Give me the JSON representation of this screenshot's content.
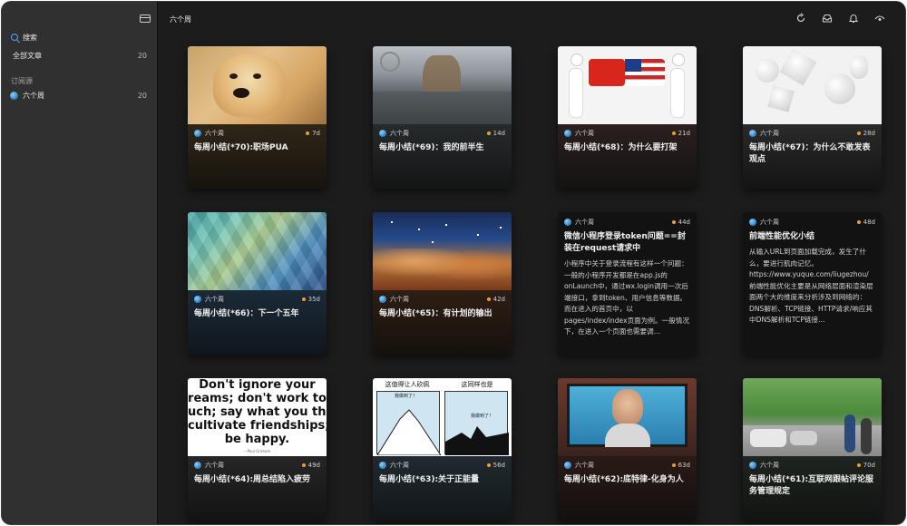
{
  "sidebar": {
    "items": [
      {
        "label": "搜索",
        "icon": "search-icon"
      },
      {
        "label": "全部文章",
        "count": "20"
      }
    ],
    "section_title": "订阅源",
    "feeds": [
      {
        "label": "六个周",
        "count": "20",
        "icon": "feed-avatar-icon"
      }
    ]
  },
  "header": {
    "title": "六个周",
    "icons": [
      "refresh-icon",
      "inbox-icon",
      "bell-icon",
      "eye-icon"
    ]
  },
  "cards": [
    {
      "feed": "六个周",
      "age": "7d",
      "title": "每周小结(*70):职场PUA",
      "excerpt": ""
    },
    {
      "feed": "六个周",
      "age": "14d",
      "title": "每周小结(*69)：我的前半生",
      "excerpt": ""
    },
    {
      "feed": "六个周",
      "age": "21d",
      "title": "每周小结(*68)：为什么要打架",
      "excerpt": ""
    },
    {
      "feed": "六个周",
      "age": "28d",
      "title": "每周小结(*67)：为什么不敢发表观点",
      "excerpt": ""
    },
    {
      "feed": "六个周",
      "age": "35d",
      "title": "每周小结(*66)：下一个五年",
      "excerpt": ""
    },
    {
      "feed": "六个周",
      "age": "42d",
      "title": "每周小结(*65)：有计划的输出",
      "excerpt": ""
    },
    {
      "feed": "六个周",
      "age": "44d",
      "title": "微信小程序登录token问题==封装在request请求中",
      "excerpt": "小程序中关于登录流程有这样一个问题：一般的小程序开发都是在app.js的onLaunch中，通过wx.login调用一次后端接口，拿到token、用户信息等数据。而在进入的首页中，以pages/index/index页面为例。一般情况下，在进入一个页面也需要调…"
    },
    {
      "feed": "六个周",
      "age": "48d",
      "title": "前端性能优化小结",
      "excerpt": "从输入URL到页面加载完成，发生了什么，要进行肌肉记忆。https://www.yuque.com/liugezhou/前端性能优化主要是从网络层面和渲染层面两个大的维度来分析涉及到网络的：DNS解析、TCP链接、HTTP请求/响应其中DNS解析和TCP链接…"
    },
    {
      "feed": "六个周",
      "age": "49d",
      "title": "每周小结(*64):周总结陷入疲劳",
      "excerpt": "",
      "image_text": [
        "Don't ignore your",
        "reams; don't work to",
        "uch; say what you thi",
        "cultivate friendships;",
        "be happy."
      ],
      "image_caption": "—Paul Graham"
    },
    {
      "feed": "六个周",
      "age": "56d",
      "title": "每周小结(*63):关于正能量",
      "excerpt": "",
      "image_text": [
        "这值得让人砍佩",
        "这同样也是",
        "我做到了！",
        "我做到了！"
      ]
    },
    {
      "feed": "六个周",
      "age": "63d",
      "title": "每周小结(*62):底特律-化身为人",
      "excerpt": ""
    },
    {
      "feed": "六个周",
      "age": "70d",
      "title": "每周小结(*61):互联网跟帖评论服务管理规定",
      "excerpt": ""
    }
  ]
}
